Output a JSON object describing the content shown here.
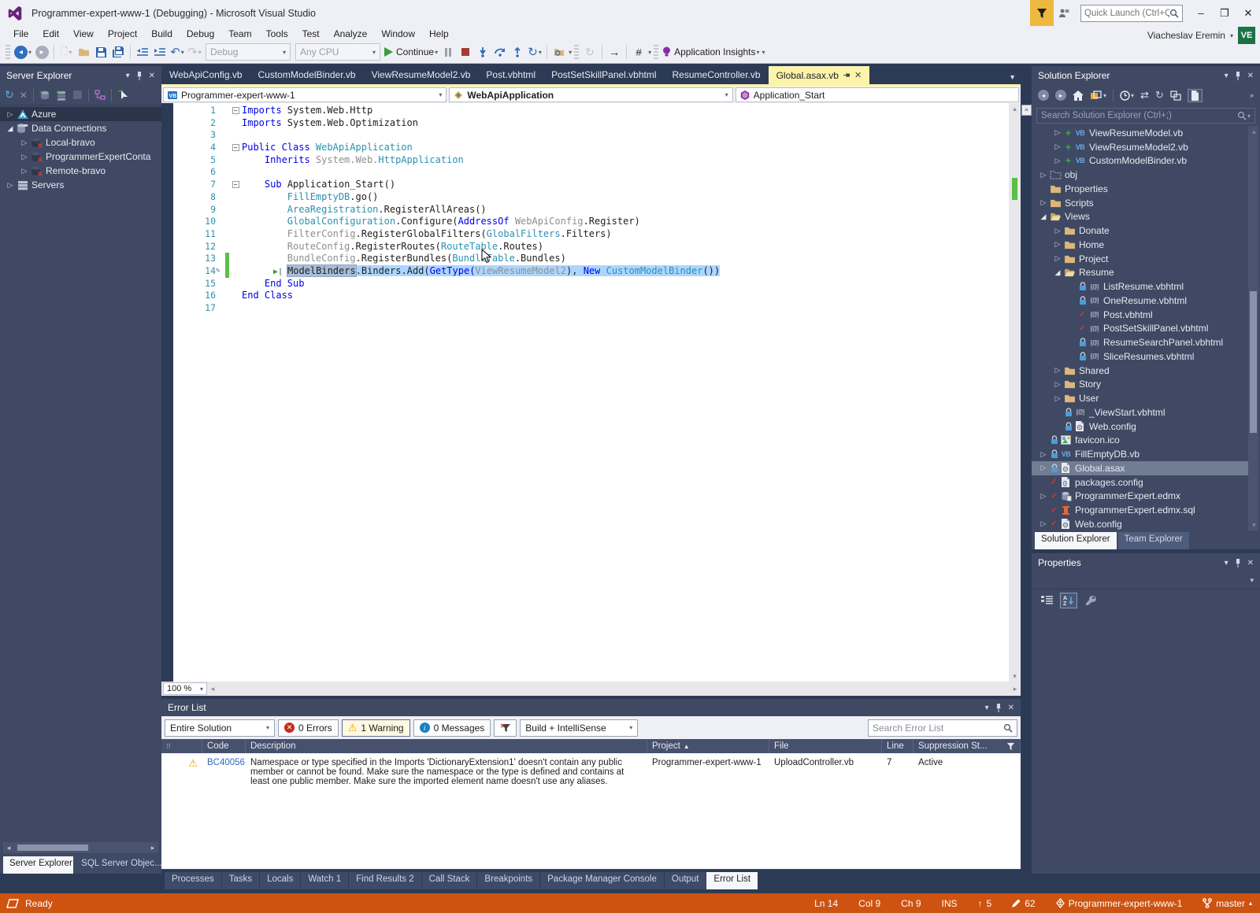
{
  "window": {
    "title": "Programmer-expert-www-1 (Debugging) - Microsoft Visual Studio",
    "quick_launch_placeholder": "Quick Launch (Ctrl+Q)",
    "user_name": "Viacheslav Eremin",
    "avatar": "VE",
    "minimize": "–",
    "restore": "❐",
    "close": "✕"
  },
  "menu": [
    "File",
    "Edit",
    "View",
    "Project",
    "Build",
    "Debug",
    "Team",
    "Tools",
    "Test",
    "Analyze",
    "Window",
    "Help"
  ],
  "toolbar": {
    "debug_config": "Debug",
    "platform": "Any CPU",
    "continue_label": "Continue",
    "app_insights_label": "Application Insights"
  },
  "doc_tabs": [
    {
      "label": "WebApiConfig.vb",
      "active": false
    },
    {
      "label": "CustomModelBinder.vb",
      "active": false
    },
    {
      "label": "ViewResumeModel2.vb",
      "active": false
    },
    {
      "label": "Post.vbhtml",
      "active": false
    },
    {
      "label": "PostSetSkillPanel.vbhtml",
      "active": false
    },
    {
      "label": "ResumeController.vb",
      "active": false
    },
    {
      "label": "Global.asax.vb",
      "active": true
    }
  ],
  "navbar": {
    "project": "Programmer-expert-www-1",
    "type": "WebApiApplication",
    "member": "Application_Start"
  },
  "editor": {
    "zoom": "100 %",
    "lines": [
      {
        "n": 1,
        "fold": true,
        "tokens": [
          [
            "kw",
            "Imports"
          ],
          [
            "pl",
            " System.Web.Http"
          ]
        ]
      },
      {
        "n": 2,
        "tokens": [
          [
            "kw",
            "Imports"
          ],
          [
            "pl",
            " System.Web.Optimization"
          ]
        ]
      },
      {
        "n": 3,
        "tokens": []
      },
      {
        "n": 4,
        "fold": true,
        "tokens": [
          [
            "kw",
            "Public Class"
          ],
          [
            "ty",
            " WebApiApplication"
          ]
        ]
      },
      {
        "n": 5,
        "tokens": [
          [
            "pl",
            "    "
          ],
          [
            "kw",
            "Inherits"
          ],
          [
            "dim",
            " System.Web."
          ],
          [
            "ty",
            "HttpApplication"
          ]
        ]
      },
      {
        "n": 6,
        "tokens": []
      },
      {
        "n": 7,
        "fold": true,
        "tokens": [
          [
            "pl",
            "    "
          ],
          [
            "kw",
            "Sub"
          ],
          [
            "pl",
            " Application_Start()"
          ]
        ]
      },
      {
        "n": 8,
        "tokens": [
          [
            "pl",
            "        "
          ],
          [
            "ty",
            "FillEmptyDB"
          ],
          [
            "pl",
            ".go()"
          ]
        ]
      },
      {
        "n": 9,
        "tokens": [
          [
            "pl",
            "        "
          ],
          [
            "ty",
            "AreaRegistration"
          ],
          [
            "pl",
            ".RegisterAllAreas()"
          ]
        ]
      },
      {
        "n": 10,
        "tokens": [
          [
            "pl",
            "        "
          ],
          [
            "ty",
            "GlobalConfiguration"
          ],
          [
            "pl",
            ".Configure("
          ],
          [
            "kw",
            "AddressOf"
          ],
          [
            "dim",
            " WebApiConfig"
          ],
          [
            "pl",
            ".Register)"
          ]
        ]
      },
      {
        "n": 11,
        "bp": true,
        "tokens": [
          [
            "pl",
            "        "
          ],
          [
            "dim",
            "FilterConfig"
          ],
          [
            "pl",
            ".RegisterGlobalFilters("
          ],
          [
            "ty",
            "GlobalFilters"
          ],
          [
            "pl",
            ".Filters)"
          ]
        ]
      },
      {
        "n": 12,
        "tokens": [
          [
            "pl",
            "        "
          ],
          [
            "dim",
            "RouteConfig"
          ],
          [
            "pl",
            ".RegisterRoutes("
          ],
          [
            "ty",
            "RouteTable"
          ],
          [
            "pl",
            ".Routes)"
          ]
        ]
      },
      {
        "n": 13,
        "change": true,
        "tokens": [
          [
            "pl",
            "        "
          ],
          [
            "dim",
            "BundleConfig"
          ],
          [
            "pl",
            ".RegisterBundles("
          ],
          [
            "ty",
            "BundleTable"
          ],
          [
            "pl",
            ".Bundles)"
          ]
        ]
      },
      {
        "n": 14,
        "change": true,
        "pencil": true,
        "exec": true,
        "sel": true,
        "tokens": [
          [
            "box",
            "ModelBinders"
          ],
          [
            "pl",
            ".Binders.Add("
          ],
          [
            "kw",
            "GetType("
          ],
          [
            "dim",
            "ViewResumeModel2"
          ],
          [
            "pl",
            "), "
          ],
          [
            "kw",
            "New"
          ],
          [
            "ty",
            " CustomModelBinder"
          ],
          [
            "pl",
            "())"
          ]
        ]
      },
      {
        "n": 15,
        "tokens": [
          [
            "pl",
            "    "
          ],
          [
            "kw",
            "End Sub"
          ]
        ]
      },
      {
        "n": 16,
        "tokens": [
          [
            "kw",
            "End Class"
          ]
        ]
      },
      {
        "n": 17,
        "tokens": []
      }
    ]
  },
  "server_explorer": {
    "title": "Server Explorer",
    "items": [
      {
        "e": "c",
        "i": "azure",
        "l": "Azure",
        "d": 0,
        "sel": true
      },
      {
        "e": "e",
        "i": "db-multi",
        "l": "Data Connections",
        "d": 0
      },
      {
        "e": "c",
        "i": "db-x",
        "l": "Local-bravo",
        "d": 1
      },
      {
        "e": "c",
        "i": "db-x",
        "l": "ProgrammerExpertConta",
        "d": 1
      },
      {
        "e": "c",
        "i": "db-x",
        "l": "Remote-bravo",
        "d": 1
      },
      {
        "e": "c",
        "i": "servers",
        "l": "Servers",
        "d": 0
      }
    ],
    "tabs": [
      {
        "label": "Server Explorer",
        "active": true
      },
      {
        "label": "SQL Server Objec...",
        "active": false
      }
    ]
  },
  "solution_explorer": {
    "title": "Solution Explorer",
    "search_placeholder": "Search Solution Explorer (Ctrl+;)",
    "items": [
      {
        "e": "c",
        "s": "add",
        "i": "vb",
        "l": "ViewResumeModel.vb",
        "d": 1
      },
      {
        "e": "c",
        "s": "add",
        "i": "vb",
        "l": "ViewResumeModel2.vb",
        "d": 1
      },
      {
        "e": "c",
        "s": "add",
        "i": "vb",
        "l": "CustomModelBinder.vb",
        "d": 1
      },
      {
        "e": "c",
        "s": null,
        "i": "folder-dotted",
        "l": "obj",
        "d": 0
      },
      {
        "e": null,
        "s": null,
        "i": "folder",
        "l": "Properties",
        "d": 0
      },
      {
        "e": "c",
        "s": null,
        "i": "folder",
        "l": "Scripts",
        "d": 0
      },
      {
        "e": "e",
        "s": null,
        "i": "folder-open",
        "l": "Views",
        "d": 0
      },
      {
        "e": "c",
        "s": null,
        "i": "folder",
        "l": "Donate",
        "d": 1
      },
      {
        "e": "c",
        "s": null,
        "i": "folder",
        "l": "Home",
        "d": 1
      },
      {
        "e": "c",
        "s": null,
        "i": "folder",
        "l": "Project",
        "d": 1
      },
      {
        "e": "e",
        "s": null,
        "i": "folder-open",
        "l": "Resume",
        "d": 1
      },
      {
        "e": null,
        "s": "lock",
        "i": "razor",
        "l": "ListResume.vbhtml",
        "d": 2
      },
      {
        "e": null,
        "s": "lock",
        "i": "razor",
        "l": "OneResume.vbhtml",
        "d": 2
      },
      {
        "e": null,
        "s": "chk",
        "i": "razor",
        "l": "Post.vbhtml",
        "d": 2
      },
      {
        "e": null,
        "s": "chk",
        "i": "razor",
        "l": "PostSetSkillPanel.vbhtml",
        "d": 2
      },
      {
        "e": null,
        "s": "lock",
        "i": "razor",
        "l": "ResumeSearchPanel.vbhtml",
        "d": 2
      },
      {
        "e": null,
        "s": "lock",
        "i": "razor",
        "l": "SliceResumes.vbhtml",
        "d": 2
      },
      {
        "e": "c",
        "s": null,
        "i": "folder",
        "l": "Shared",
        "d": 1
      },
      {
        "e": "c",
        "s": null,
        "i": "folder",
        "l": "Story",
        "d": 1
      },
      {
        "e": "c",
        "s": null,
        "i": "folder",
        "l": "User",
        "d": 1
      },
      {
        "e": null,
        "s": "lock",
        "i": "razor",
        "l": "_ViewStart.vbhtml",
        "d": 1
      },
      {
        "e": null,
        "s": "lock",
        "i": "config",
        "l": "Web.config",
        "d": 1
      },
      {
        "e": null,
        "s": "lock",
        "i": "ico",
        "l": "favicon.ico",
        "d": 0
      },
      {
        "e": "c",
        "s": "lock",
        "i": "vblt",
        "l": "FillEmptyDB.vb",
        "d": 0
      },
      {
        "e": "c",
        "s": "lock",
        "i": "config",
        "l": "Global.asax",
        "d": 0,
        "sel": true
      },
      {
        "e": null,
        "s": "chk",
        "i": "pkg",
        "l": "packages.config",
        "d": 0
      },
      {
        "e": "c",
        "s": "chk",
        "i": "edmx",
        "l": "ProgrammerExpert.edmx",
        "d": 0
      },
      {
        "e": null,
        "s": "chk",
        "i": "sql",
        "l": "ProgrammerExpert.edmx.sql",
        "d": 0
      },
      {
        "e": "c",
        "s": "chk",
        "i": "config",
        "l": "Web.config",
        "d": 0
      }
    ],
    "tabs": [
      {
        "label": "Solution Explorer",
        "active": true
      },
      {
        "label": "Team Explorer",
        "active": false
      }
    ]
  },
  "properties": {
    "title": "Properties"
  },
  "error_list": {
    "title": "Error List",
    "scope": "Entire Solution",
    "errors_label": "0 Errors",
    "warnings_label": "1 Warning",
    "messages_label": "0 Messages",
    "filter_combo": "Build + IntelliSense",
    "search_placeholder": "Search Error List",
    "columns": [
      "Code",
      "Description",
      "Project",
      "File",
      "Line",
      "Suppression St..."
    ],
    "row": {
      "code": "BC40056",
      "description": "Namespace or type specified in the Imports 'DictionaryExtension1' doesn't contain any public member or cannot be found. Make sure the namespace or the type is defined and contains at least one public member. Make sure the imported element name doesn't use any aliases.",
      "project": "Programmer-expert-www-1",
      "file": "UploadController.vb",
      "line": "7",
      "suppression": "Active"
    }
  },
  "bottom_tabs": [
    {
      "label": "Processes",
      "active": false
    },
    {
      "label": "Tasks",
      "active": false
    },
    {
      "label": "Locals",
      "active": false
    },
    {
      "label": "Watch 1",
      "active": false
    },
    {
      "label": "Find Results 2",
      "active": false
    },
    {
      "label": "Call Stack",
      "active": false
    },
    {
      "label": "Breakpoints",
      "active": false
    },
    {
      "label": "Package Manager Console",
      "active": false
    },
    {
      "label": "Output",
      "active": false
    },
    {
      "label": "Error List",
      "active": true
    }
  ],
  "status_bar": {
    "ready": "Ready",
    "right": [
      {
        "icon": null,
        "label": "Ln 14"
      },
      {
        "icon": null,
        "label": "Col 9"
      },
      {
        "icon": null,
        "label": "Ch 9"
      },
      {
        "icon": null,
        "label": "INS"
      },
      {
        "icon": "arrow-up",
        "label": "5"
      },
      {
        "icon": "pencil",
        "label": "62"
      },
      {
        "icon": "sync-diamond",
        "label": "Programmer-expert-www-1"
      },
      {
        "icon": "branch",
        "label": "master",
        "caret": "▴"
      }
    ]
  },
  "colors": {
    "status_orange": "#CE5310",
    "active_tab_yellow": "#FCF4AA",
    "selection_blue": "#ADD6FF",
    "change_green": "#5CBE46",
    "keyword_blue": "#0000E8",
    "type_teal": "#2B91AF"
  }
}
